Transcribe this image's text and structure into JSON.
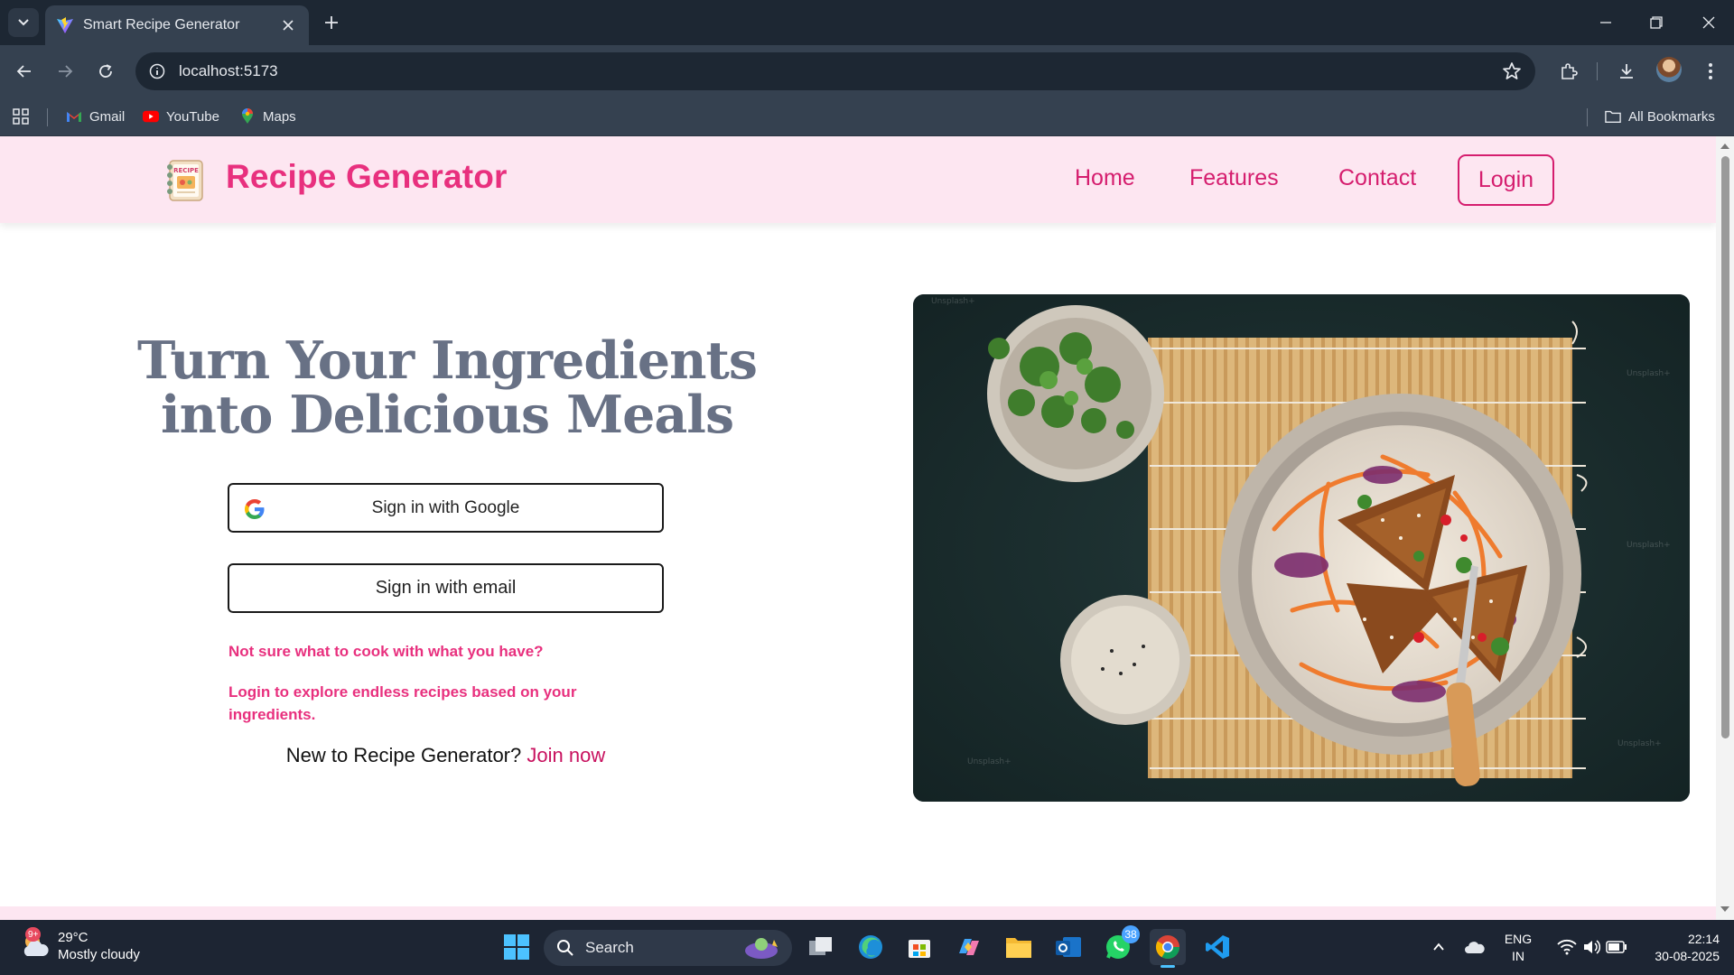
{
  "browser": {
    "tab_title": "Smart Recipe Generator",
    "url": "localhost:5173",
    "bookmarks": [
      {
        "label": "Gmail",
        "icon": "gmail-icon"
      },
      {
        "label": "YouTube",
        "icon": "youtube-icon"
      },
      {
        "label": "Maps",
        "icon": "maps-icon"
      }
    ],
    "all_bookmarks": "All Bookmarks"
  },
  "site": {
    "brand": "Recipe Generator",
    "logo_text": "RECIPE",
    "nav": [
      "Home",
      "Features",
      "Contact"
    ],
    "login": "Login",
    "accent_color": "#e8307e"
  },
  "hero": {
    "title_line1": "Turn Your Ingredients",
    "title_line2": "into Delicious Meals",
    "google_button": "Sign in with Google",
    "email_button": "Sign in with email",
    "note1": "Not sure what to cook with what you have?",
    "note2": "Login to explore endless recipes based on your ingredients.",
    "join_prefix": "New to Recipe Generator?",
    "join_link": "Join now",
    "image_watermark": "Unsplash+"
  },
  "taskbar": {
    "temperature": "29°C",
    "weather": "Mostly cloudy",
    "weather_badge": "9+",
    "search": "Search",
    "whatsapp_badge": "38",
    "language": "ENG",
    "region": "IN",
    "time": "22:14",
    "date": "30-08-2025"
  }
}
